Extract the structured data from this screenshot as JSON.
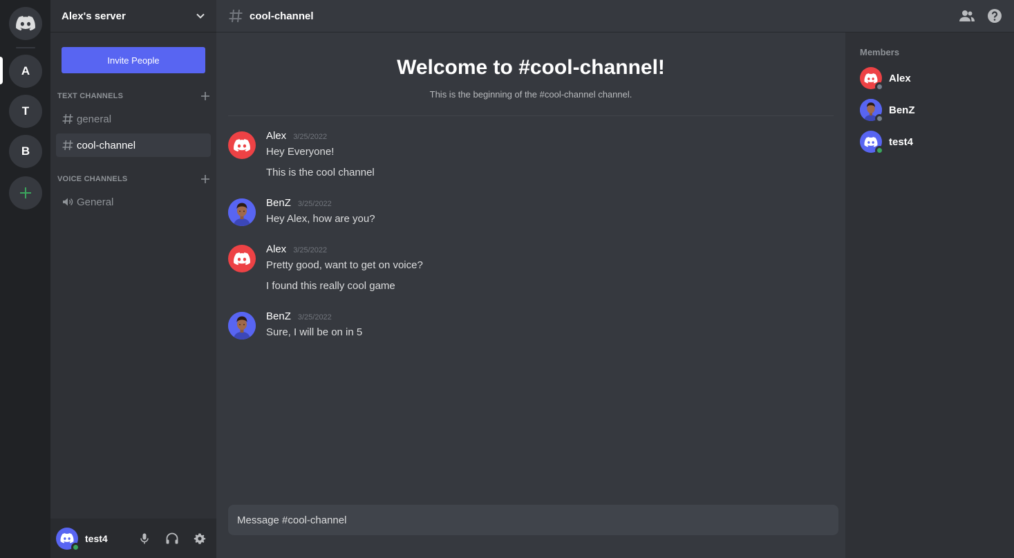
{
  "rail": {
    "servers": [
      {
        "label": "A"
      },
      {
        "label": "T"
      },
      {
        "label": "B"
      }
    ]
  },
  "sidebar": {
    "server_name": "Alex's server",
    "invite_label": "Invite People",
    "text_category": "TEXT CHANNELS",
    "voice_category": "VOICE CHANNELS",
    "text_channels": [
      {
        "name": "general",
        "active": false
      },
      {
        "name": "cool-channel",
        "active": true
      }
    ],
    "voice_channels": [
      {
        "name": "General"
      }
    ]
  },
  "userbar": {
    "username": "test4",
    "status_color": "#3ba55d"
  },
  "header": {
    "channel_name": "cool-channel"
  },
  "welcome": {
    "title": "Welcome to #cool-channel!",
    "subtitle": "This is the beginning of the #cool-channel channel."
  },
  "messages": [
    {
      "author": "Alex",
      "time": "3/25/2022",
      "avatar": "discord-red",
      "lines": [
        "Hey Everyone!",
        "This is the cool channel"
      ]
    },
    {
      "author": "BenZ",
      "time": "3/25/2022",
      "avatar": "person",
      "lines": [
        "Hey Alex, how are you?"
      ]
    },
    {
      "author": "Alex",
      "time": "3/25/2022",
      "avatar": "discord-red",
      "lines": [
        "Pretty good, want to get on voice?",
        "I found this really cool game"
      ]
    },
    {
      "author": "BenZ",
      "time": "3/25/2022",
      "avatar": "person",
      "lines": [
        "Sure, I will be on in 5"
      ]
    }
  ],
  "composer": {
    "placeholder": "Message #cool-channel"
  },
  "members": {
    "title": "Members",
    "list": [
      {
        "name": "Alex",
        "avatar": "discord-red",
        "status": "offline"
      },
      {
        "name": "BenZ",
        "avatar": "person",
        "status": "offline"
      },
      {
        "name": "test4",
        "avatar": "discord-blue",
        "status": "online"
      }
    ]
  },
  "colors": {
    "blurple": "#5865f2",
    "red": "#ed4245",
    "green": "#3ba55d",
    "offline": "#747f8d"
  }
}
